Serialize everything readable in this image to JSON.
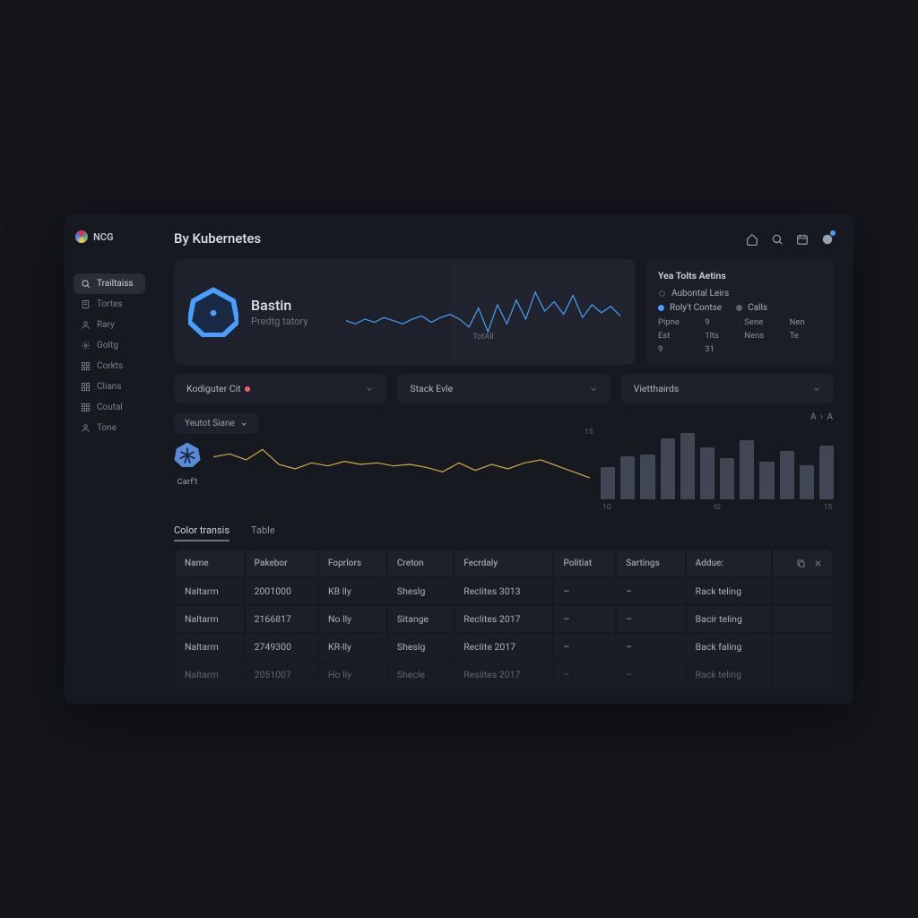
{
  "brand": "NCG",
  "page_title": "By Kubernetes",
  "sidebar": {
    "items": [
      {
        "label": "Trailtaiss",
        "icon": "search"
      },
      {
        "label": "Tortes",
        "icon": "doc"
      },
      {
        "label": "Rary",
        "icon": "user"
      },
      {
        "label": "Goltg",
        "icon": "gear"
      },
      {
        "label": "Corkts",
        "icon": "grid"
      },
      {
        "label": "Clians",
        "icon": "grid"
      },
      {
        "label": "Coutal",
        "icon": "grid"
      },
      {
        "label": "Tone",
        "icon": "user"
      }
    ],
    "active_index": 0
  },
  "hero": {
    "title": "Bastin",
    "subtitle": "Predtg tatory",
    "xlabel": "TotAll"
  },
  "actions": {
    "title": "Yea Tolts Aetins",
    "link_label": "Aubontal Leirs",
    "legend": [
      {
        "label": "Roly't Contse",
        "color": "blue"
      },
      {
        "label": "Calls",
        "color": "gray"
      }
    ],
    "grid": [
      "Pipne",
      "9",
      "Sene",
      "Nen",
      "Est",
      "1lts",
      "Nens",
      "Te",
      "9",
      "31"
    ]
  },
  "selects": [
    {
      "label": "Kodiguter Cit",
      "badge": true
    },
    {
      "label": "Stack Evle",
      "badge": false
    },
    {
      "label": "Vietthairds",
      "badge": false
    }
  ],
  "chip_label": "Yeutot Siane",
  "line_logo_label": "Carf't",
  "breadcrumb": "A  ›  A",
  "tabs": [
    {
      "label": "Color transis",
      "active": true
    },
    {
      "label": "Table",
      "active": false
    }
  ],
  "table": {
    "columns": [
      "Name",
      "Pakebor",
      "Foprlors",
      "Creton",
      "Fecrdaly",
      "Politiat",
      "Sartings",
      "Addue:"
    ],
    "rows": [
      [
        "Naltarm",
        "2001000",
        "KB lly",
        "Sheslg",
        "Reclites 3013",
        "–",
        "–",
        "Rack teling"
      ],
      [
        "Naltarm",
        "2166817",
        "No lly",
        "Sitange",
        "Reclites 2017",
        "–",
        "–",
        "Bacir teling"
      ],
      [
        "Naltarm",
        "2749300",
        "KR-lly",
        "Sheslg",
        "Reclite 2017",
        "–",
        "–",
        "Back faling"
      ],
      [
        "Naltarm",
        "2051007",
        "Ho lly",
        "Shecle",
        "Reslites 2017",
        "–",
        "–",
        "Rack teling"
      ]
    ]
  },
  "chart_data": {
    "hero_line": {
      "type": "line",
      "x": [
        0,
        1,
        2,
        3,
        4,
        5,
        6,
        7,
        8,
        9,
        10,
        11,
        12,
        13,
        14,
        15,
        16,
        17,
        18,
        19,
        20,
        21,
        22,
        23,
        24,
        25,
        26,
        27,
        28,
        29
      ],
      "values": [
        32,
        30,
        33,
        31,
        34,
        32,
        30,
        33,
        35,
        31,
        34,
        36,
        33,
        28,
        40,
        25,
        42,
        30,
        45,
        33,
        50,
        38,
        44,
        36,
        48,
        34,
        42,
        37,
        41,
        35
      ],
      "ylim": [
        20,
        55
      ],
      "color": "#4a9eff",
      "xlabel": "TotAll"
    },
    "mid_line": {
      "type": "line",
      "x": [
        0,
        1,
        2,
        3,
        4,
        5,
        6,
        7,
        8,
        9,
        10,
        11,
        12,
        13,
        14,
        15,
        16,
        17,
        18,
        19,
        20,
        21,
        22,
        23
      ],
      "values": [
        50,
        52,
        48,
        55,
        45,
        42,
        46,
        44,
        47,
        45,
        46,
        44,
        45,
        43,
        40,
        46,
        41,
        45,
        42,
        46,
        48,
        44,
        40,
        36
      ],
      "ylim": [
        30,
        60
      ],
      "color": "#d4a94a"
    },
    "bars": {
      "type": "bar",
      "categories": [
        "·",
        "·",
        "·",
        "·",
        "·",
        "·",
        "·",
        "·",
        "·",
        "·",
        "·",
        "·"
      ],
      "values": [
        45,
        60,
        62,
        85,
        92,
        72,
        58,
        82,
        52,
        68,
        48,
        75
      ],
      "ylim": [
        0,
        100
      ],
      "xticks": [
        "10",
        "t0",
        "15"
      ],
      "ytick": "15"
    }
  }
}
